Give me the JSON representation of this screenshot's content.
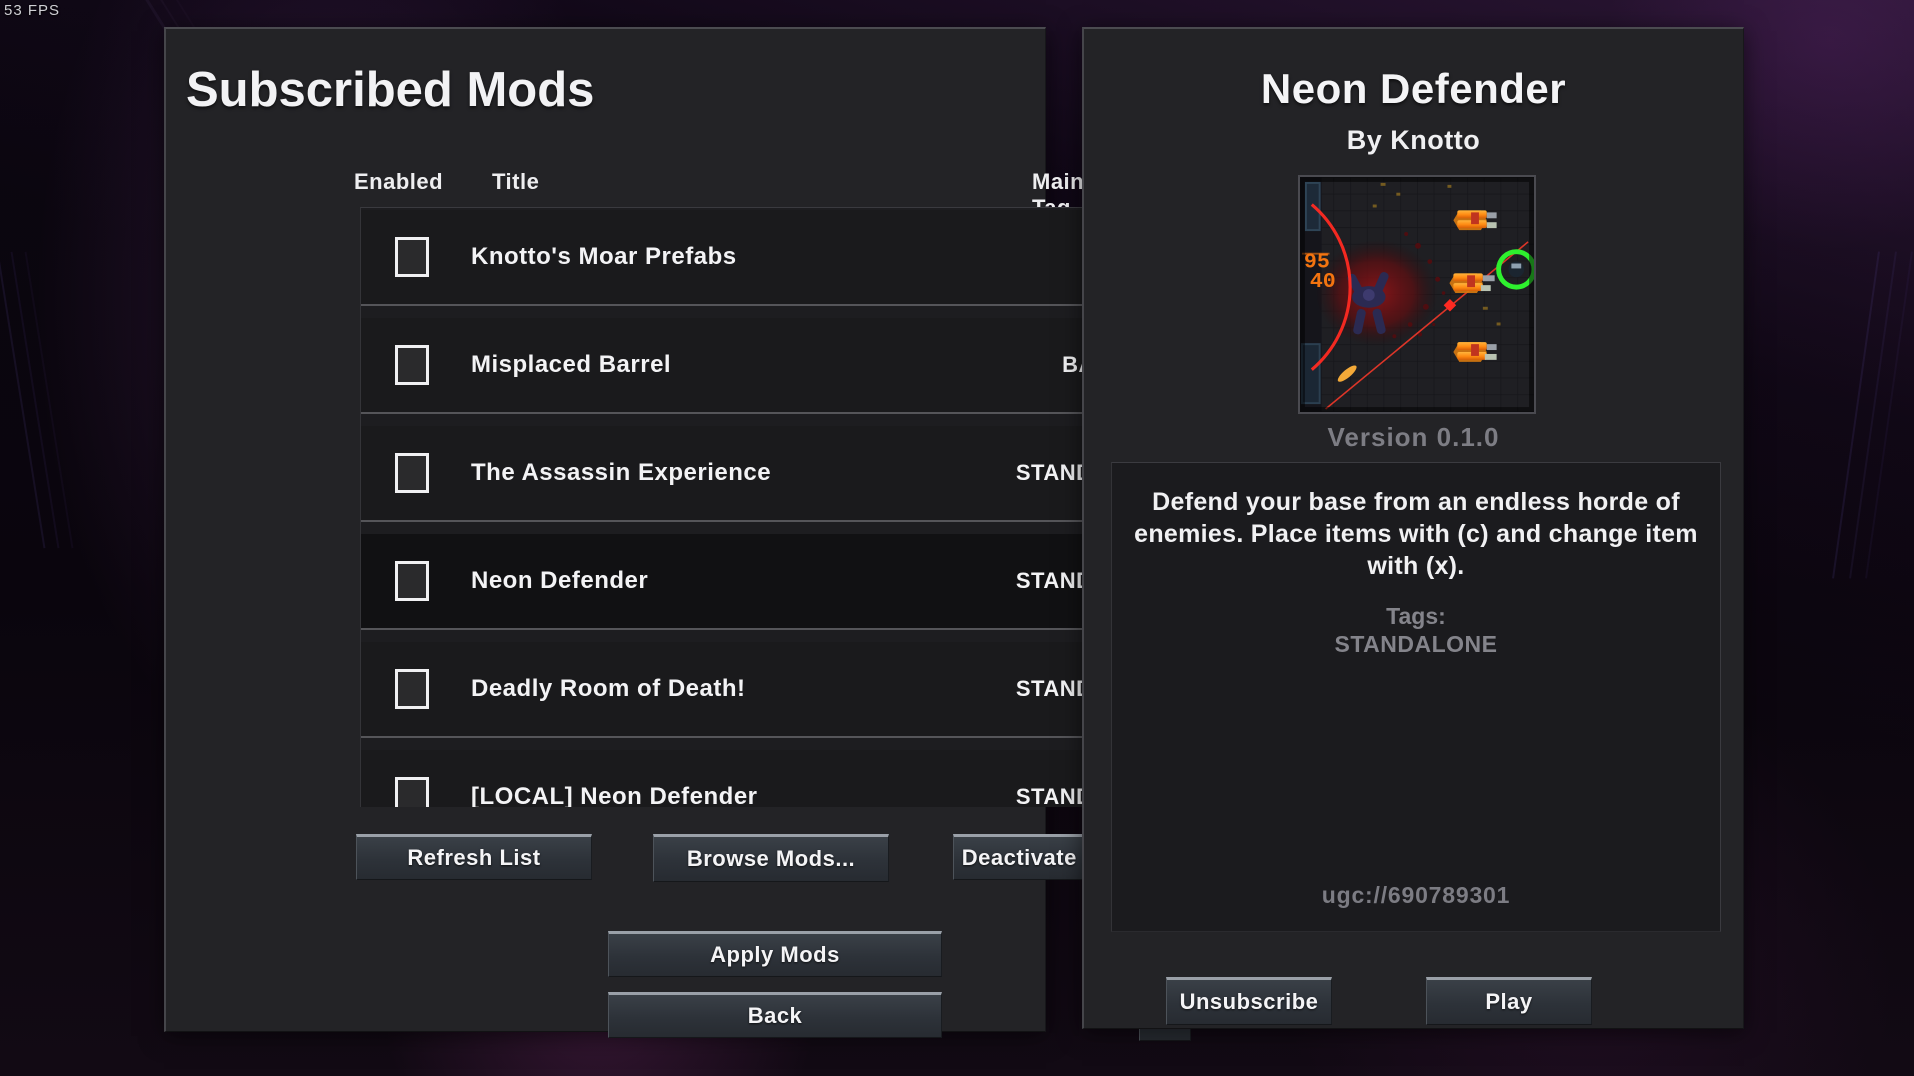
{
  "hud": {
    "fps": "53 FPS"
  },
  "left_panel": {
    "title": "Subscribed Mods",
    "columns": {
      "enabled": "Enabled",
      "title": "Title",
      "main_tag": "Main Tag"
    },
    "rows": [
      {
        "title": "Knotto's Moar Prefabs",
        "tag": "-",
        "enabled": false,
        "selected": false
      },
      {
        "title": "Misplaced Barrel",
        "tag": "BARRELS",
        "enabled": false,
        "selected": false
      },
      {
        "title": "The Assassin Experience",
        "tag": "STANDALONE",
        "enabled": false,
        "selected": false
      },
      {
        "title": "Neon Defender",
        "tag": "STANDALONE",
        "enabled": false,
        "selected": true
      },
      {
        "title": "Deadly Room of Death!",
        "tag": "STANDALONE",
        "enabled": false,
        "selected": false
      },
      {
        "title": "[LOCAL] Neon Defender",
        "tag": "STANDALONE",
        "enabled": false,
        "selected": false
      }
    ],
    "buttons": {
      "refresh": "Refresh List",
      "browse": "Browse Mods...",
      "deactivate": "Deactivate All Mods",
      "apply": "Apply Mods",
      "back": "Back",
      "tools_icon": "wrench-hammer-icon"
    }
  },
  "right_panel": {
    "mod_name": "Neon Defender",
    "author": "By Knotto",
    "version": "Version 0.1.0",
    "description": "Defend your base from an endless horde of enemies. Place items with (c) and change item with (x).",
    "tags_label": "Tags:",
    "tags_value": "STANDALONE",
    "ugc_id": "ugc://690789301",
    "buttons": {
      "unsubscribe": "Unsubscribe",
      "play": "Play"
    },
    "thumbnail": {
      "name": "neon-defender-preview",
      "description": "Top-down pixel scene: dark tiled floor with blood splatter, red circular arc, three orange turrets on the right, a green ring indicator, red laser beam and orange neon numbers on the left wall.",
      "colors": {
        "floor": "#2a2a30",
        "blood": "#6e1418",
        "arc": "#ff2a22",
        "turret": "#ff8c1a",
        "ring": "#2ef02e",
        "neon_text": "#ff7a10"
      }
    }
  },
  "theme": {
    "panel_bg": "#232326",
    "row_bg": "#1a1a1c",
    "row_selected_bg": "#111113",
    "text": "#f3f3f5",
    "muted_text": "#7d7d84",
    "button_top_highlight": "#9aa0a8"
  }
}
